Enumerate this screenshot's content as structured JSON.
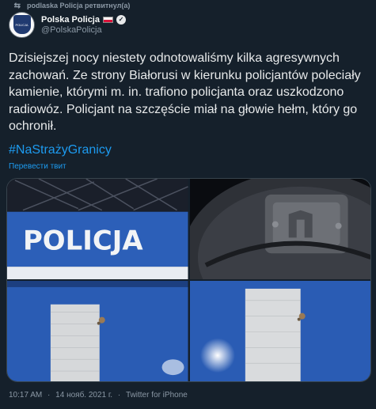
{
  "retweet": {
    "icon": "retweet-icon",
    "text": "podlaska Policja ретвитнул(а)"
  },
  "author": {
    "display_name": "Polska Policja",
    "handle": "@PolskaPolicja",
    "avatar_text": "POLICJA",
    "flag_icon": "poland-flag-icon",
    "verified_icon": "verified-badge-icon"
  },
  "tweet": {
    "text": "Dzisiejszej nocy niestety odnotowaliśmy kilka agresywnych zachowań. Ze strony Białorusi w kierunku policjantów poleciały kamienie, którymi m. in. trafiono policjanta oraz uszkodzono radiowóz. Policjant na szczęście miał na głowie hełm, który go ochronił.",
    "hashtag": "#NaStrażyGranicy",
    "translate_label": "Перевести твит"
  },
  "photos": {
    "car_label": "POLICJA",
    "colors": {
      "blue": "#2b5fb5",
      "dark": "#0d1220",
      "helmet": "#3a3d44",
      "reflective": "#d8d8d8"
    }
  },
  "meta": {
    "time": "10:17 AM",
    "date": "14 нояб. 2021 г.",
    "source": "Twitter for iPhone",
    "separator": "·"
  },
  "colors": {
    "background": "#15202b",
    "accent": "#1d9bf0",
    "muted": "#8b98a5",
    "text": "#e7e9ea"
  }
}
